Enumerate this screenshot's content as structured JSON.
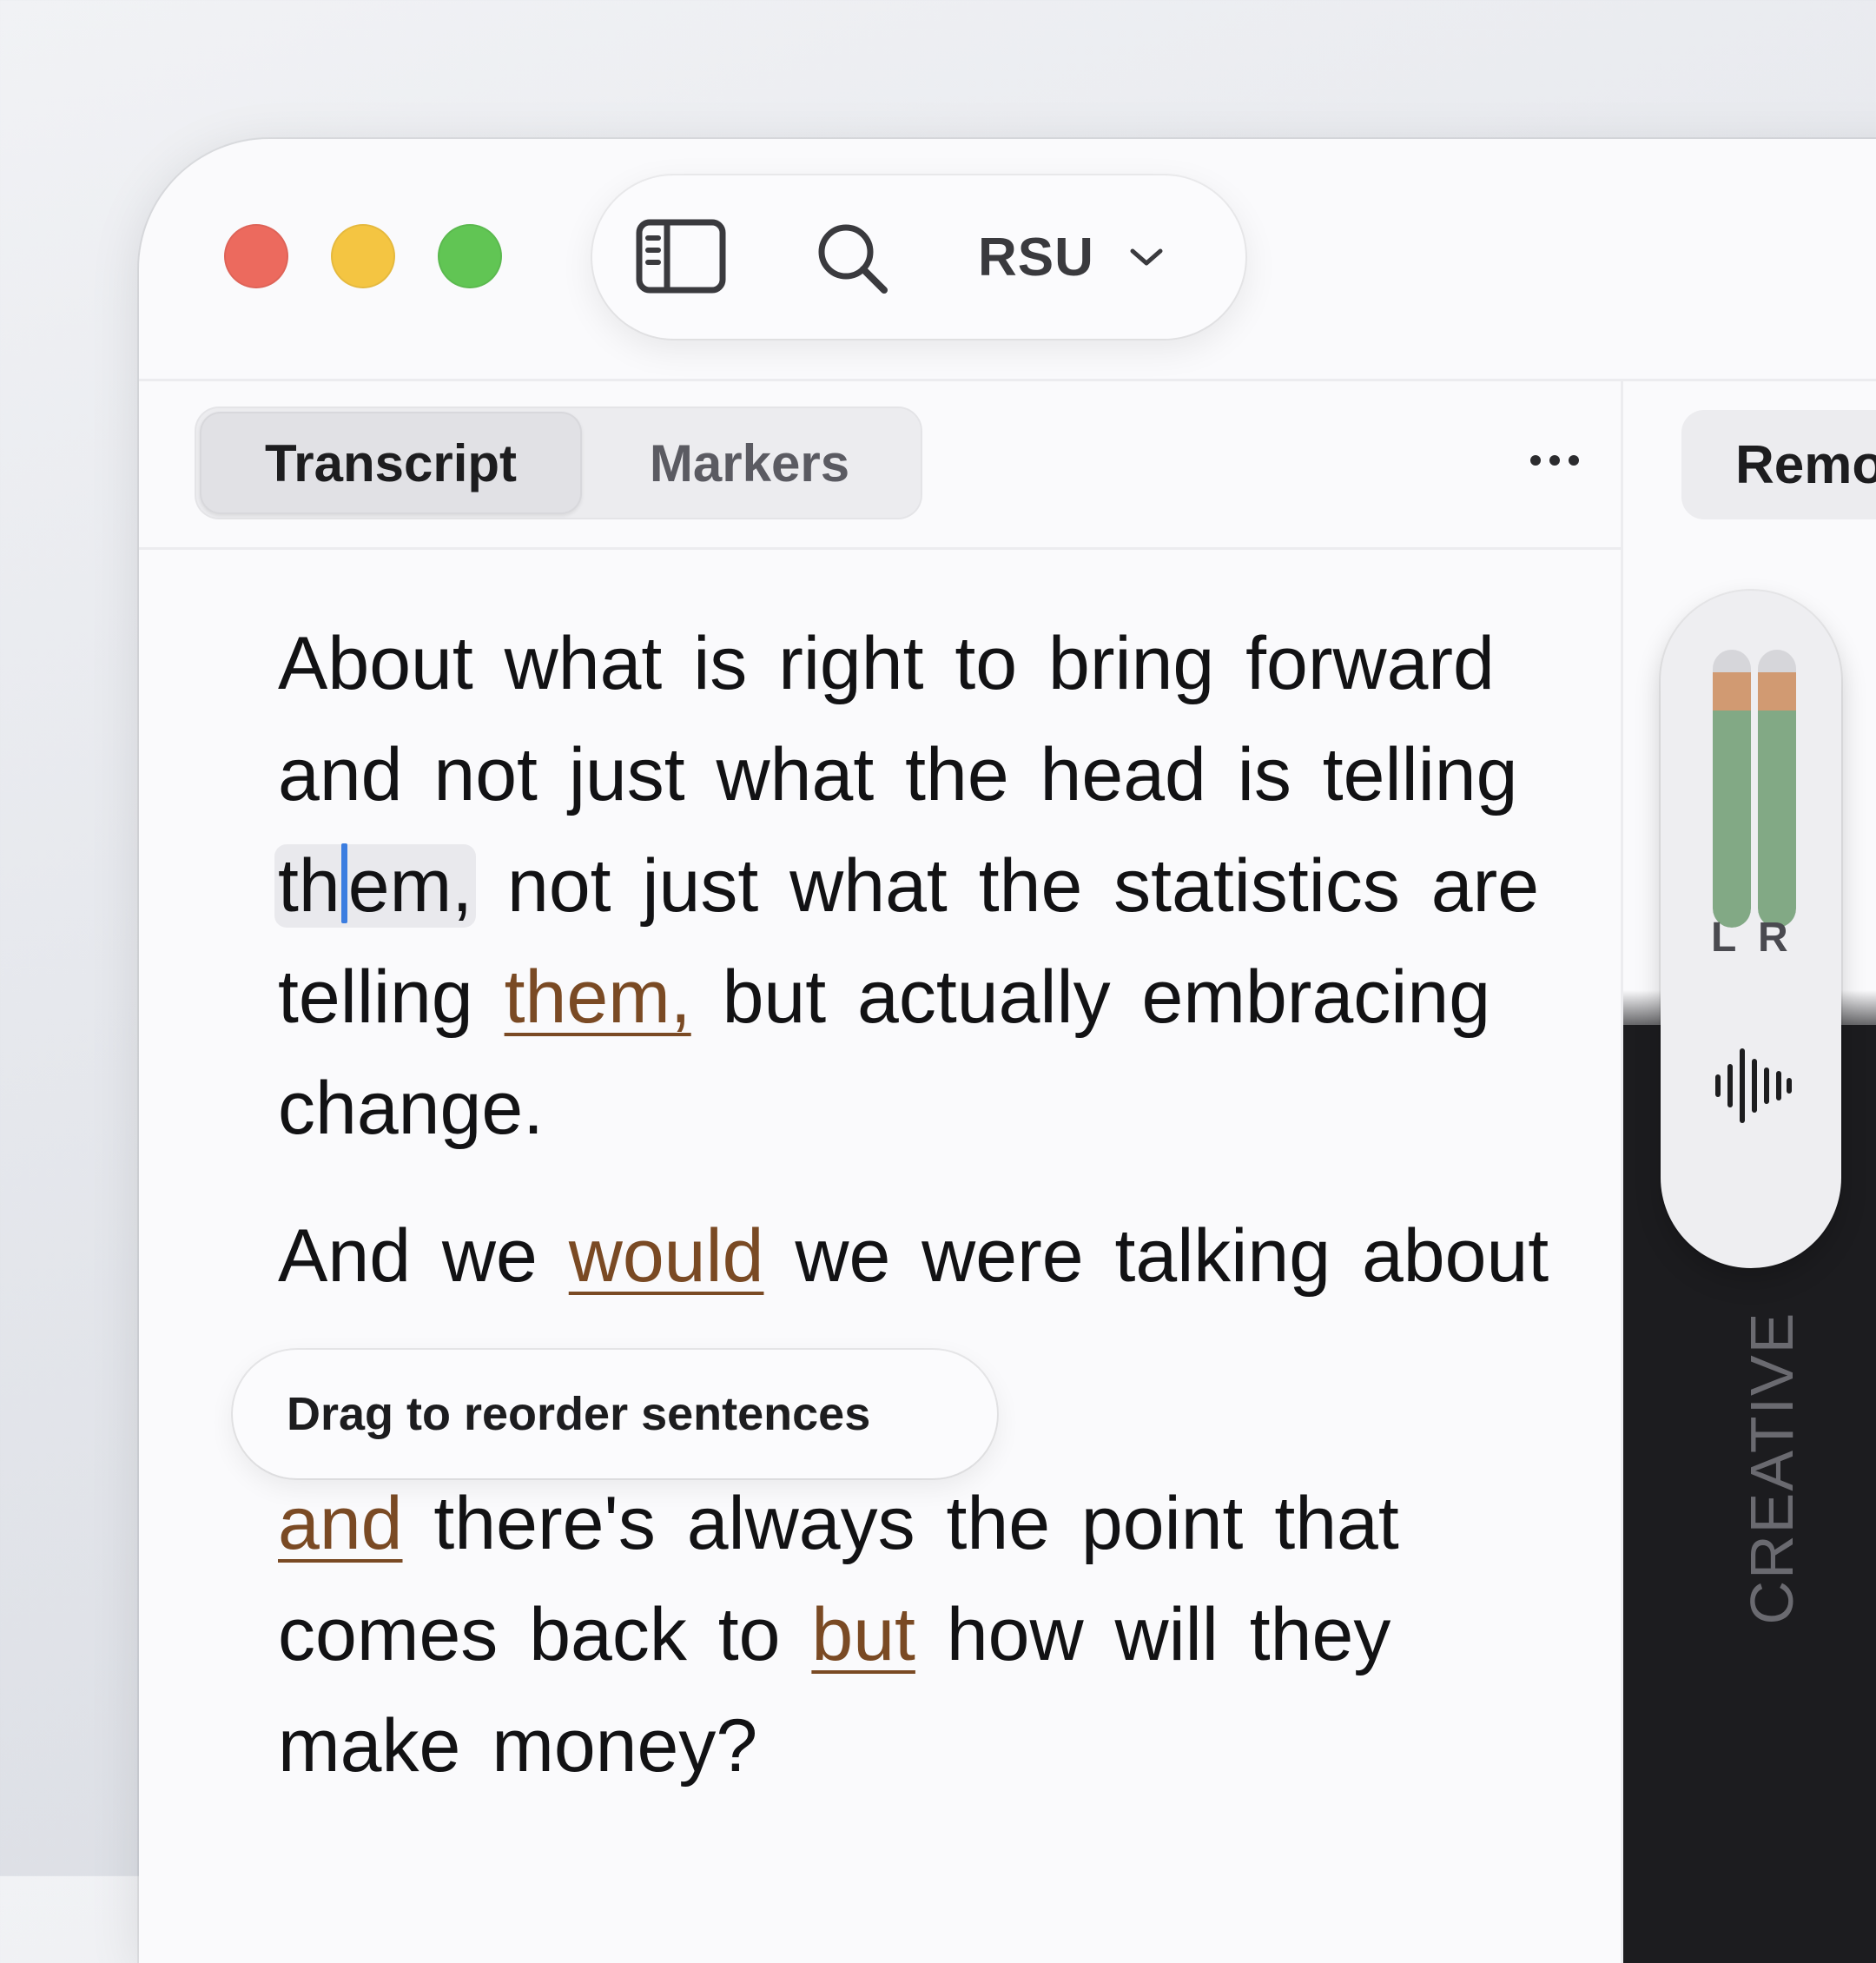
{
  "toolbar": {
    "sidebar_icon": "sidebar-icon",
    "search_icon": "search-icon",
    "workspace_label": "RSU"
  },
  "tabs": [
    {
      "label": "Transcript",
      "active": true
    },
    {
      "label": "Markers",
      "active": false
    }
  ],
  "right_panel": {
    "tab_label_partial": "Remo",
    "meter": {
      "left_label": "L",
      "right_label": "R",
      "left_level": 0.92,
      "right_level": 0.92
    },
    "background_text": "CREATIVE"
  },
  "transcript": {
    "para1": {
      "line1": "About what is right to bring forward",
      "line2": "and not just what the head is telling",
      "word_hl_a": "th",
      "word_hl_b": "em,",
      "line3_rest": " not just what the statistics are",
      "line4_a": "telling ",
      "line4_filler": "them,",
      "line4_b": " but actually embracing",
      "line5": "change."
    },
    "para2": {
      "a": "And we ",
      "filler": "would",
      "b": " we were talking about"
    },
    "para3": {
      "filler1": "and",
      "line1_rest": " there's always the point that",
      "line2_a": "comes back to ",
      "filler2": "but",
      "line2_b": " how will they",
      "line3": "make money?"
    }
  },
  "tooltip": "Drag to reorder sentences",
  "colors": {
    "filler": "#7a4a24",
    "caret": "#3b7de0",
    "meter_green": "#82a985",
    "meter_hot": "#d19a72"
  }
}
